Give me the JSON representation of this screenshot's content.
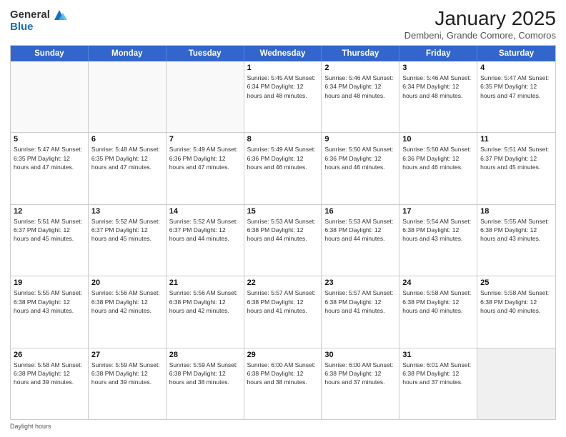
{
  "header": {
    "title": "January 2025",
    "subtitle": "Dembeni, Grande Comore, Comoros",
    "logo_general": "General",
    "logo_blue": "Blue"
  },
  "days_of_week": [
    "Sunday",
    "Monday",
    "Tuesday",
    "Wednesday",
    "Thursday",
    "Friday",
    "Saturday"
  ],
  "weeks": [
    [
      {
        "day": "",
        "info": ""
      },
      {
        "day": "",
        "info": ""
      },
      {
        "day": "",
        "info": ""
      },
      {
        "day": "1",
        "info": "Sunrise: 5:45 AM\nSunset: 6:34 PM\nDaylight: 12 hours\nand 48 minutes."
      },
      {
        "day": "2",
        "info": "Sunrise: 5:46 AM\nSunset: 6:34 PM\nDaylight: 12 hours\nand 48 minutes."
      },
      {
        "day": "3",
        "info": "Sunrise: 5:46 AM\nSunset: 6:34 PM\nDaylight: 12 hours\nand 48 minutes."
      },
      {
        "day": "4",
        "info": "Sunrise: 5:47 AM\nSunset: 6:35 PM\nDaylight: 12 hours\nand 47 minutes."
      }
    ],
    [
      {
        "day": "5",
        "info": "Sunrise: 5:47 AM\nSunset: 6:35 PM\nDaylight: 12 hours\nand 47 minutes."
      },
      {
        "day": "6",
        "info": "Sunrise: 5:48 AM\nSunset: 6:35 PM\nDaylight: 12 hours\nand 47 minutes."
      },
      {
        "day": "7",
        "info": "Sunrise: 5:49 AM\nSunset: 6:36 PM\nDaylight: 12 hours\nand 47 minutes."
      },
      {
        "day": "8",
        "info": "Sunrise: 5:49 AM\nSunset: 6:36 PM\nDaylight: 12 hours\nand 46 minutes."
      },
      {
        "day": "9",
        "info": "Sunrise: 5:50 AM\nSunset: 6:36 PM\nDaylight: 12 hours\nand 46 minutes."
      },
      {
        "day": "10",
        "info": "Sunrise: 5:50 AM\nSunset: 6:36 PM\nDaylight: 12 hours\nand 46 minutes."
      },
      {
        "day": "11",
        "info": "Sunrise: 5:51 AM\nSunset: 6:37 PM\nDaylight: 12 hours\nand 45 minutes."
      }
    ],
    [
      {
        "day": "12",
        "info": "Sunrise: 5:51 AM\nSunset: 6:37 PM\nDaylight: 12 hours\nand 45 minutes."
      },
      {
        "day": "13",
        "info": "Sunrise: 5:52 AM\nSunset: 6:37 PM\nDaylight: 12 hours\nand 45 minutes."
      },
      {
        "day": "14",
        "info": "Sunrise: 5:52 AM\nSunset: 6:37 PM\nDaylight: 12 hours\nand 44 minutes."
      },
      {
        "day": "15",
        "info": "Sunrise: 5:53 AM\nSunset: 6:38 PM\nDaylight: 12 hours\nand 44 minutes."
      },
      {
        "day": "16",
        "info": "Sunrise: 5:53 AM\nSunset: 6:38 PM\nDaylight: 12 hours\nand 44 minutes."
      },
      {
        "day": "17",
        "info": "Sunrise: 5:54 AM\nSunset: 6:38 PM\nDaylight: 12 hours\nand 43 minutes."
      },
      {
        "day": "18",
        "info": "Sunrise: 5:55 AM\nSunset: 6:38 PM\nDaylight: 12 hours\nand 43 minutes."
      }
    ],
    [
      {
        "day": "19",
        "info": "Sunrise: 5:55 AM\nSunset: 6:38 PM\nDaylight: 12 hours\nand 43 minutes."
      },
      {
        "day": "20",
        "info": "Sunrise: 5:56 AM\nSunset: 6:38 PM\nDaylight: 12 hours\nand 42 minutes."
      },
      {
        "day": "21",
        "info": "Sunrise: 5:56 AM\nSunset: 6:38 PM\nDaylight: 12 hours\nand 42 minutes."
      },
      {
        "day": "22",
        "info": "Sunrise: 5:57 AM\nSunset: 6:38 PM\nDaylight: 12 hours\nand 41 minutes."
      },
      {
        "day": "23",
        "info": "Sunrise: 5:57 AM\nSunset: 6:38 PM\nDaylight: 12 hours\nand 41 minutes."
      },
      {
        "day": "24",
        "info": "Sunrise: 5:58 AM\nSunset: 6:38 PM\nDaylight: 12 hours\nand 40 minutes."
      },
      {
        "day": "25",
        "info": "Sunrise: 5:58 AM\nSunset: 6:38 PM\nDaylight: 12 hours\nand 40 minutes."
      }
    ],
    [
      {
        "day": "26",
        "info": "Sunrise: 5:58 AM\nSunset: 6:38 PM\nDaylight: 12 hours\nand 39 minutes."
      },
      {
        "day": "27",
        "info": "Sunrise: 5:59 AM\nSunset: 6:38 PM\nDaylight: 12 hours\nand 39 minutes."
      },
      {
        "day": "28",
        "info": "Sunrise: 5:59 AM\nSunset: 6:38 PM\nDaylight: 12 hours\nand 38 minutes."
      },
      {
        "day": "29",
        "info": "Sunrise: 6:00 AM\nSunset: 6:38 PM\nDaylight: 12 hours\nand 38 minutes."
      },
      {
        "day": "30",
        "info": "Sunrise: 6:00 AM\nSunset: 6:38 PM\nDaylight: 12 hours\nand 37 minutes."
      },
      {
        "day": "31",
        "info": "Sunrise: 6:01 AM\nSunset: 6:38 PM\nDaylight: 12 hours\nand 37 minutes."
      },
      {
        "day": "",
        "info": ""
      }
    ]
  ],
  "footer": "Daylight hours"
}
